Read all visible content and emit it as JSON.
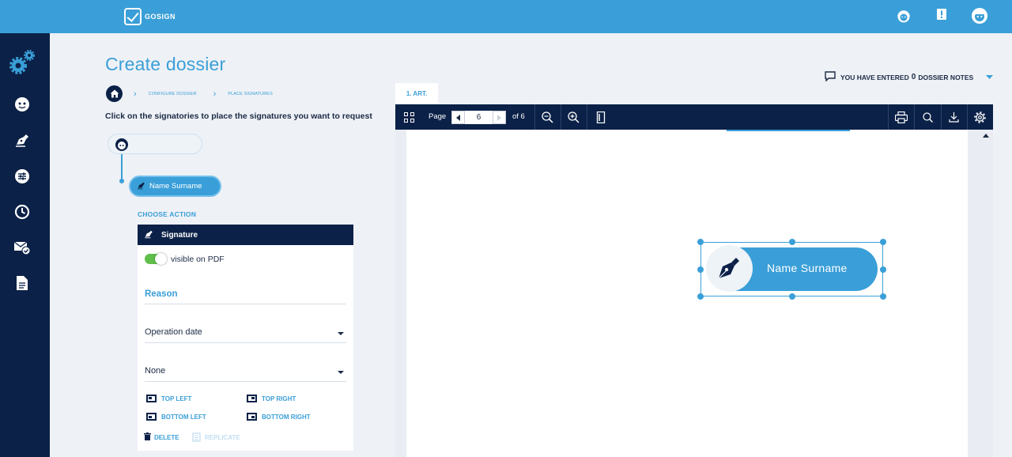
{
  "app": {
    "logo_text": "GOSIGN"
  },
  "header": {
    "title": "Create dossier",
    "notes_prefix": "YOU HAVE ENTERED",
    "notes_count": "0",
    "notes_suffix": "DOSSIER NOTES"
  },
  "breadcrumb": {
    "step1": "CONFIGURE DOSSIER",
    "step2": "PLACE SIGNATURES"
  },
  "instruction": "Click on the signatories to place the signatures you want to request",
  "signatory": {
    "name": "Name Surname"
  },
  "action": {
    "choose_label": "CHOOSE ACTION",
    "type": "Signature",
    "visible_label": "visible on PDF",
    "visible_on": true,
    "reason_label": "Reason",
    "date_select": "Operation date",
    "second_select": "None",
    "positions": {
      "top_left": "TOP LEFT",
      "top_right": "TOP RIGHT",
      "bottom_left": "BOTTOM LEFT",
      "bottom_right": "BOTTOM RIGHT"
    },
    "delete_label": "DELETE",
    "replicate_label": "REPLICATE"
  },
  "viewer": {
    "tab_label": "1. ART.",
    "page_label": "Page",
    "current_page": "6",
    "of_label": "of 6"
  },
  "signature_field": {
    "name": "Name Surname"
  },
  "colors": {
    "primary": "#3a9fd8",
    "navy": "#0b2147",
    "background": "#eef1f6",
    "toggle_on": "#5fbf4a"
  }
}
